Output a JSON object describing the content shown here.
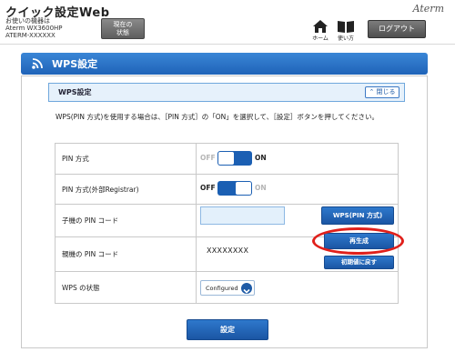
{
  "header": {
    "app_title": "クイック設定Web",
    "device_lines": [
      "お使いの機器は",
      "Aterm WX3600HP",
      "ATERM-XXXXXX"
    ],
    "state_button": [
      "現在の",
      "状態"
    ],
    "brand": "Aterm",
    "home_label": "ホーム",
    "help_label": "使い方",
    "logout_label": "ログアウト"
  },
  "page": {
    "title": "WPS設定",
    "section_title": "WPS設定",
    "close_label": "閉じる",
    "description": "WPS(PIN 方式)を使用する場合は、［PIN 方式］の「ON」を選択して、［設定］ボタンを押してください。"
  },
  "rows": {
    "pin_method": {
      "label": "PIN 方式",
      "off": "OFF",
      "on": "ON",
      "state": "on"
    },
    "pin_registrar": {
      "label": "PIN 方式(外部Registrar)",
      "off": "OFF",
      "on": "ON",
      "state": "off"
    },
    "child_pin": {
      "label": "子機の PIN コード",
      "input_value": "",
      "button": "WPS(PIN 方式)"
    },
    "parent_pin": {
      "label": "親機の PIN コード",
      "value": "XXXXXXXX",
      "regen_button": "再生成",
      "reset_button": "初期値に戻す"
    },
    "wps_status": {
      "label": "WPS の状態",
      "selected": "Configured"
    }
  },
  "footer": {
    "submit_label": "設定"
  },
  "colors": {
    "accent": "#1f63b8",
    "highlight_ring": "#e0201b",
    "section_bg": "#e6f1fb"
  }
}
